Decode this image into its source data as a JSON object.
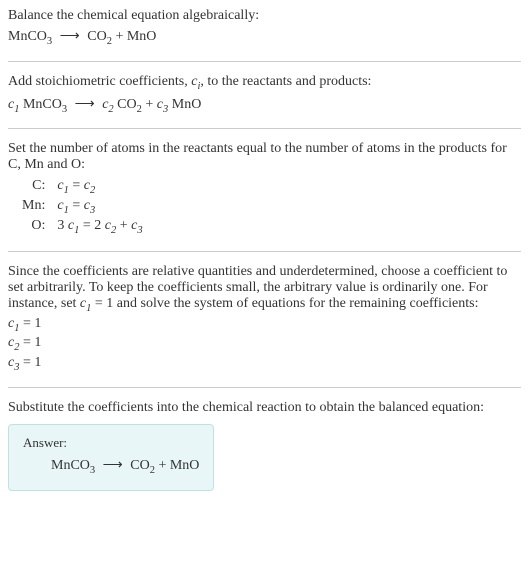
{
  "section1": {
    "title": "Balance the chemical equation algebraically:",
    "eq_left": "MnCO",
    "eq_left_sub": "3",
    "arrow": "⟶",
    "eq_r1": "CO",
    "eq_r1_sub": "2",
    "plus": " + ",
    "eq_r2": "MnO"
  },
  "section2": {
    "title_a": "Add stoichiometric coefficients, ",
    "title_ci": "c",
    "title_ci_sub": "i",
    "title_b": ", to the reactants and products:",
    "c1": "c",
    "c1_sub": "1",
    "sp": " ",
    "l1": "MnCO",
    "l1_sub": "3",
    "arrow": "⟶",
    "c2": "c",
    "c2_sub": "2",
    "r1": "CO",
    "r1_sub": "2",
    "plus": " + ",
    "c3": "c",
    "c3_sub": "3",
    "r2": "MnO"
  },
  "section3": {
    "title": "Set the number of atoms in the reactants equal to the number of atoms in the products for C, Mn and O:",
    "rows": [
      {
        "elem": "C:",
        "lhs_c": "c",
        "lhs_s": "1",
        "eq": " = ",
        "rhs_c": "c",
        "rhs_s": "2",
        "extra": ""
      },
      {
        "elem": "Mn:",
        "lhs_c": "c",
        "lhs_s": "1",
        "eq": " = ",
        "rhs_c": "c",
        "rhs_s": "3",
        "extra": ""
      },
      {
        "elem": "O:",
        "pre": "3 ",
        "lhs_c": "c",
        "lhs_s": "1",
        "eq": " = ",
        "rpre": "2 ",
        "rhs_c": "c",
        "rhs_s": "2",
        "plus": " + ",
        "rhs2_c": "c",
        "rhs2_s": "3"
      }
    ]
  },
  "section4": {
    "text_a": "Since the coefficients are relative quantities and underdetermined, choose a coefficient to set arbitrarily. To keep the coefficients small, the arbitrary value is ordinarily one. For instance, set ",
    "cvar": "c",
    "csub": "1",
    "ceq": " = 1",
    "text_b": " and solve the system of equations for the remaining coefficients:",
    "results": [
      {
        "c": "c",
        "s": "1",
        "v": " = 1"
      },
      {
        "c": "c",
        "s": "2",
        "v": " = 1"
      },
      {
        "c": "c",
        "s": "3",
        "v": " = 1"
      }
    ]
  },
  "section5": {
    "title": "Substitute the coefficients into the chemical reaction to obtain the balanced equation:",
    "answer_label": "Answer:",
    "eq_left": "MnCO",
    "eq_left_sub": "3",
    "arrow": "⟶",
    "eq_r1": "CO",
    "eq_r1_sub": "2",
    "plus": " + ",
    "eq_r2": "MnO"
  }
}
